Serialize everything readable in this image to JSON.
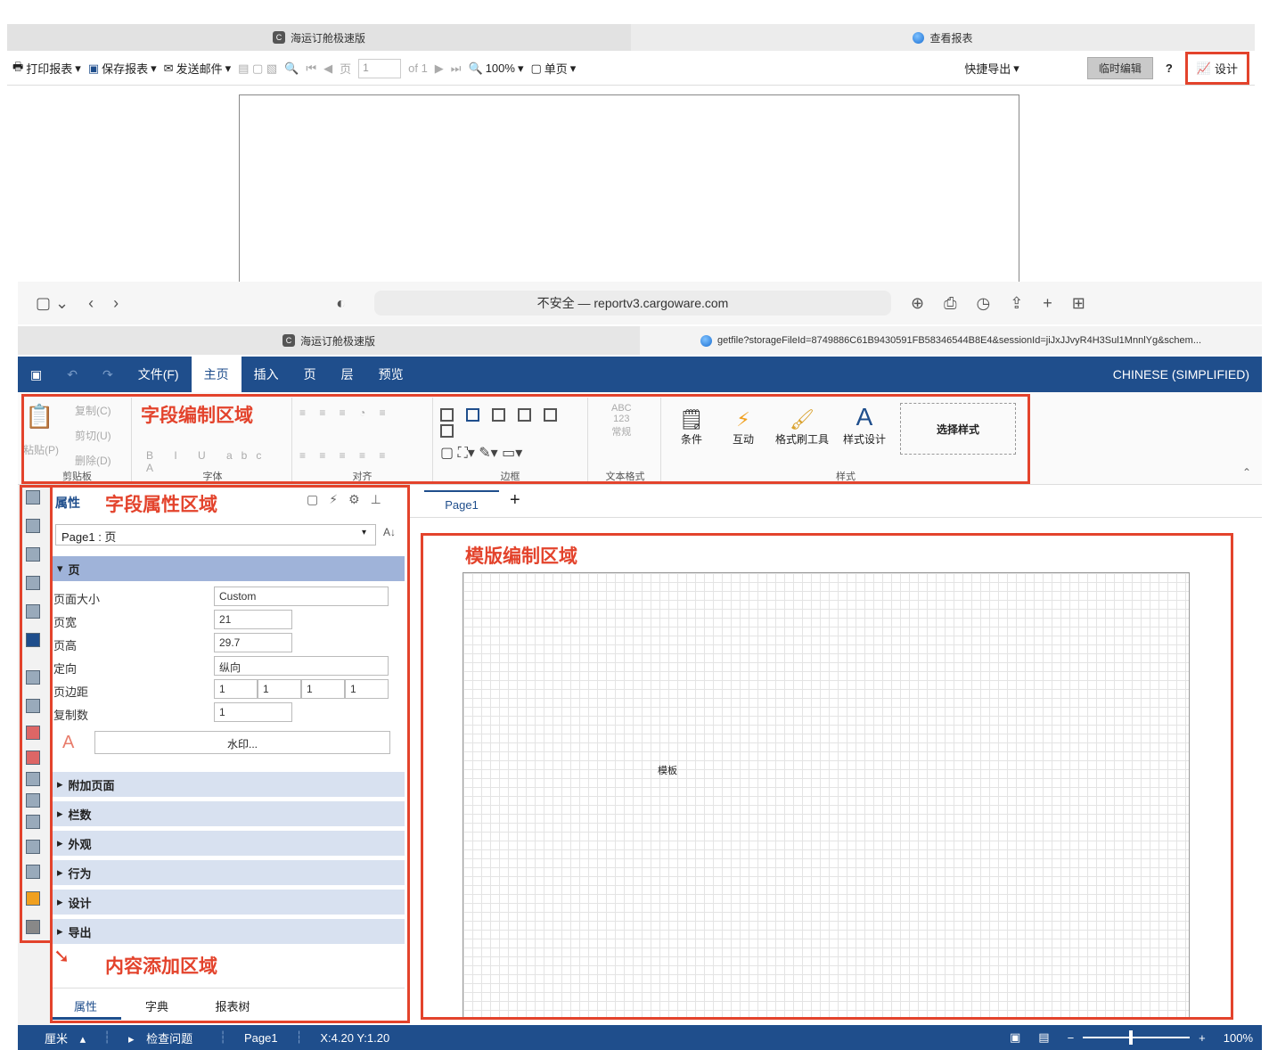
{
  "top_tabs": [
    {
      "label": "海运订舱极速版",
      "icon": "C"
    },
    {
      "label": "查看报表"
    }
  ],
  "viewer_toolbar": {
    "print": "打印报表",
    "save": "保存报表",
    "email": "发送邮件",
    "page_label": "页",
    "page_value": "1",
    "of": "of 1",
    "zoom": "100%",
    "single_page": "单页",
    "quick_export": "快捷导出",
    "temp_edit": "临时编辑",
    "help": "?",
    "design": "设计"
  },
  "browser": {
    "url": "不安全 — reportv3.cargoware.com"
  },
  "tabs2": [
    {
      "label": "海运订舱极速版",
      "icon": "C"
    },
    {
      "label": "getfile?storageFileId=8749886C61B9430591FB58346544B8E4&sessionId=jiJxJJvyR4H3Sul1MnnlYg&schem..."
    }
  ],
  "ribbon_menu": {
    "file": "文件(F)",
    "home": "主页",
    "insert": "插入",
    "page": "页",
    "layer": "层",
    "preview": "预览",
    "language": "CHINESE (SIMPLIFIED)"
  },
  "ribbon": {
    "paste": "粘贴(P)",
    "copy": "复制(C)",
    "cut": "剪切(U)",
    "delete": "删除(D)",
    "clipboard": "剪贴板",
    "font": "字体",
    "align": "对齐",
    "border": "边框",
    "text_format": "文本格式",
    "text_format_abc": "ABC",
    "text_format_123": "123",
    "text_format_normal": "常规",
    "condition": "条件",
    "interaction": "互动",
    "format_painter": "格式刷工具",
    "style_design": "样式设计",
    "select_style": "选择样式",
    "style": "样式"
  },
  "annotations": {
    "field_edit": "字段编制区域",
    "field_props": "字段属性区域",
    "template_edit": "模版编制区域",
    "content_add": "内容添加区域"
  },
  "props": {
    "title": "属性",
    "selector": "Page1 : 页",
    "section_page": "页",
    "rows": [
      {
        "label": "页面大小",
        "value": "Custom"
      },
      {
        "label": "页宽",
        "value": "21"
      },
      {
        "label": "页高",
        "value": "29.7"
      },
      {
        "label": "定向",
        "value": "纵向"
      },
      {
        "label": "页边距",
        "value": "1"
      },
      {
        "label": "复制数",
        "value": "1"
      }
    ],
    "margins": [
      "1",
      "1",
      "1",
      "1"
    ],
    "watermark": "水印...",
    "sections": [
      "附加页面",
      "栏数",
      "外观",
      "行为",
      "设计",
      "导出"
    ],
    "bottom_tabs": [
      "属性",
      "字典",
      "报表树"
    ]
  },
  "canvas": {
    "page_tab": "Page1",
    "add_tab": "+",
    "template_label": "模板"
  },
  "status": {
    "unit": "厘米",
    "check": "检查问题",
    "page": "Page1",
    "coords": "X:4.20 Y:1.20",
    "zoom": "100%"
  }
}
